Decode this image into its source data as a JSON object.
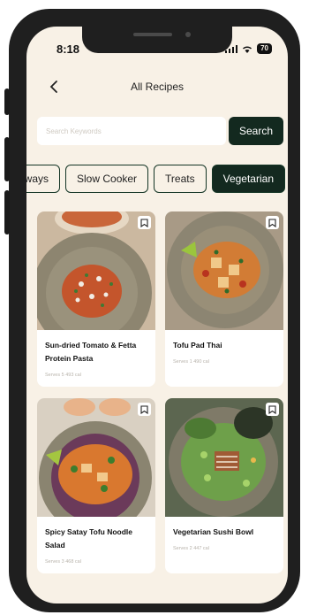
{
  "status": {
    "time": "8:18",
    "battery": "70"
  },
  "header": {
    "title": "All Recipes"
  },
  "search": {
    "placeholder": "Search Keywords",
    "button_label": "Search"
  },
  "categories": [
    {
      "label": "aways"
    },
    {
      "label": "Slow Cooker"
    },
    {
      "label": "Treats"
    },
    {
      "label": "Vegetarian",
      "selected": true
    }
  ],
  "recipes": [
    {
      "title": "Sun-dried Tomato & Fetta Protein Pasta",
      "meta": "Serves 5  493 cal"
    },
    {
      "title": "Tofu Pad Thai",
      "meta": "Serves 1  490 cal"
    },
    {
      "title": "Spicy Satay Tofu Noodle Salad",
      "meta": "Serves 3  468 cal"
    },
    {
      "title": "Vegetarian Sushi Bowl",
      "meta": "Serves 2  447 cal"
    }
  ],
  "colors": {
    "accent": "#13291f",
    "background": "#f8f1e6",
    "card": "#ffffff"
  }
}
